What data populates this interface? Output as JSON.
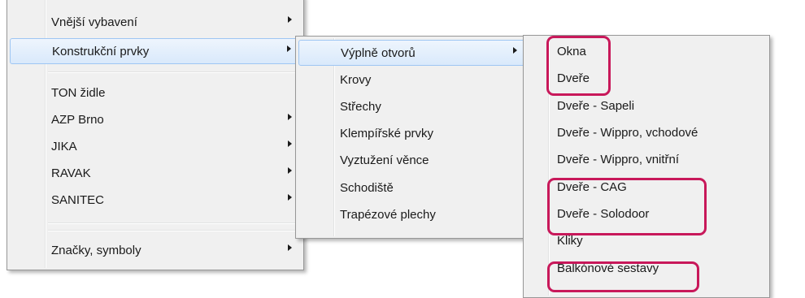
{
  "menu1": {
    "items": [
      {
        "label": "Vnější vybavení",
        "submenu": true
      },
      {
        "label": "Konstrukční prvky",
        "submenu": true,
        "highlighted": true
      },
      {
        "label": "TON židle",
        "submenu": false
      },
      {
        "label": "AZP Brno",
        "submenu": true
      },
      {
        "label": "JIKA",
        "submenu": true
      },
      {
        "label": "RAVAK",
        "submenu": true
      },
      {
        "label": "SANITEC",
        "submenu": true
      },
      {
        "label": "Značky, symboly",
        "submenu": true
      }
    ]
  },
  "menu2": {
    "items": [
      {
        "label": "Výplně otvorů",
        "submenu": true,
        "highlighted": true
      },
      {
        "label": "Krovy",
        "submenu": false
      },
      {
        "label": "Střechy",
        "submenu": false
      },
      {
        "label": "Klempířské prvky",
        "submenu": false
      },
      {
        "label": "Vyztužení věnce",
        "submenu": false
      },
      {
        "label": "Schodiště",
        "submenu": false
      },
      {
        "label": "Trapézové plechy",
        "submenu": false
      }
    ]
  },
  "menu3": {
    "items": [
      {
        "label": "Okna",
        "circled": true
      },
      {
        "label": "Dveře",
        "circled": true
      },
      {
        "label": "Dveře - Sapeli",
        "circled": false
      },
      {
        "label": "Dveře - Wippro, vchodové",
        "circled": false
      },
      {
        "label": "Dveře - Wippro, vnitřní",
        "circled": false
      },
      {
        "label": "Dveře - CAG",
        "circled": true
      },
      {
        "label": "Dveře - Solodoor",
        "circled": true
      },
      {
        "label": "Kliky",
        "circled": false
      },
      {
        "label": "Balkónové sestavy",
        "circled": true
      }
    ]
  },
  "colors": {
    "menu_background": "#f0f0f0",
    "highlight": "#d9e9fb",
    "annotation": "#c8185a"
  }
}
